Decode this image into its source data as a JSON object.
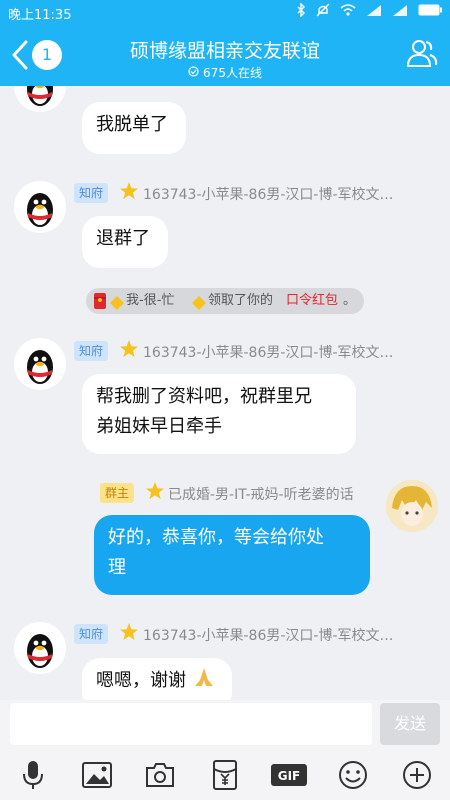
{
  "status_bar": {
    "time": "晚上11:35"
  },
  "header": {
    "back_badge": "1",
    "title": "硕博缘盟相亲交友联谊",
    "online": "675人在线"
  },
  "messages": [
    {
      "text": "我脱单了"
    },
    {
      "tag": "知府",
      "nick": "163743-小苹果-86男-汉口-博-军校文…",
      "text": "退群了"
    },
    {
      "system": {
        "user": "我-很-忙",
        "action": "领取了你的",
        "item": "口令红包",
        "end": "。"
      }
    },
    {
      "tag": "知府",
      "nick": "163743-小苹果-86男-汉口-博-军校文…",
      "text_line1": "帮我删了资料吧，祝群里兄",
      "text_line2": "弟姐妹早日牵手"
    },
    {
      "tag": "群主",
      "nick": "已成婚-男-IT-戒妈-听老婆的话",
      "text_line1": "好的，恭喜你，等会给你处",
      "text_line2": "理"
    },
    {
      "tag": "知府",
      "nick": "163743-小苹果-86男-汉口-博-军校文…",
      "text": "嗯嗯，谢谢"
    }
  ],
  "input": {
    "placeholder": "",
    "send_label": "发送"
  },
  "toolbar": {
    "gif_label": "GIF",
    "icons": [
      "microphone-icon",
      "image-icon",
      "camera-icon",
      "red-packet-icon",
      "gif-icon",
      "emoji-icon",
      "plus-icon"
    ]
  },
  "colors": {
    "primary": "#1eb4f5",
    "bubble_me": "#19a6f0",
    "red": "#e02830"
  }
}
